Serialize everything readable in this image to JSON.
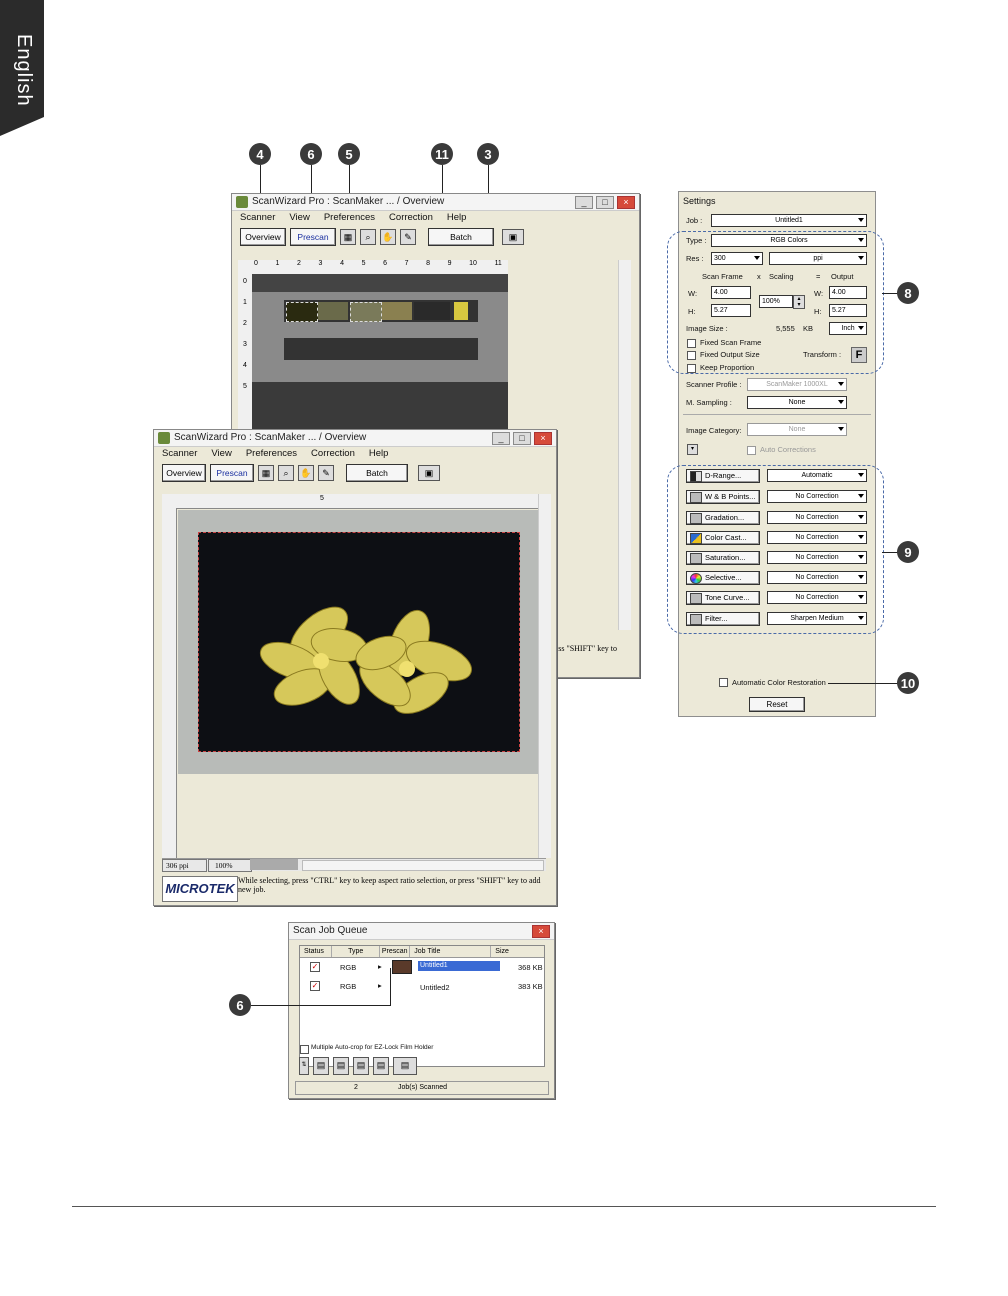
{
  "side_tab": {
    "label": "English"
  },
  "callouts": {
    "c4": "4",
    "c6a": "6",
    "c5": "5",
    "c11": "11",
    "c3": "3",
    "c8": "8",
    "c9": "9",
    "c10": "10",
    "c6b": "6"
  },
  "back_window": {
    "title": "ScanWizard Pro : ScanMaker ... / Overview",
    "menus": [
      "Scanner",
      "View",
      "Preferences",
      "Correction",
      "Help"
    ],
    "overview_label": "Overview",
    "prescan_label": "Prescan",
    "batch_label": "Batch",
    "ruler_numbers": [
      "0",
      "1",
      "2",
      "3",
      "4",
      "5",
      "6",
      "7",
      "8",
      "9",
      "10",
      "11"
    ],
    "left_ruler_numbers": [
      "0",
      "1",
      "2",
      "3",
      "4",
      "5"
    ],
    "status_text": "ress \"SHIFT\" key to"
  },
  "front_window": {
    "title": "ScanWizard Pro : ScanMaker ... / Overview",
    "menus": [
      "Scanner",
      "View",
      "Preferences",
      "Correction",
      "Help"
    ],
    "overview_label": "Overview",
    "prescan_label": "Prescan",
    "batch_label": "Batch",
    "ruler_mark": "5",
    "resolution": "306 ppi",
    "zoom": "100%",
    "brand": "MICROTEK",
    "status_text": "While selecting, press \"CTRL\" key to keep aspect ratio selection, or press \"SHIFT\" key to add new job."
  },
  "settings": {
    "title": "Settings",
    "job_label": "Job :",
    "job_value": "Untitled1",
    "type_label": "Type :",
    "type_value": "RGB Colors",
    "res_label": "Res :",
    "res_value": "300",
    "res_unit": "ppi",
    "scan_frame_label": "Scan Frame",
    "x_label": "x",
    "scaling_label": "Scaling",
    "eq_label": "=",
    "output_label": "Output",
    "w_label": "W:",
    "h_label": "H:",
    "w_value": "4.00",
    "h_value": "5.27",
    "scale_value": "100%",
    "out_w_value": "4.00",
    "out_h_value": "5.27",
    "image_size_label": "Image Size :",
    "image_size_value": "5,555",
    "image_size_unit": "KB",
    "inch_value": "Inch",
    "fixed_scan_frame": "Fixed Scan Frame",
    "fixed_output_size": "Fixed Output Size",
    "transform_label": "Transform :",
    "transform_glyph": "F",
    "keep_proportion": "Keep Proportion",
    "scanner_profile_label": "Scanner Profile :",
    "scanner_profile_value": "ScanMaker 1000XL",
    "m_sampling_label": "M. Sampling :",
    "m_sampling_value": "None",
    "image_category_label": "Image Category:",
    "image_category_value": "None",
    "auto_corrections": "Auto Corrections",
    "tools": [
      {
        "label": "D-Range...",
        "value": "Automatic"
      },
      {
        "label": "W & B Points...",
        "value": "No Correction"
      },
      {
        "label": "Gradation...",
        "value": "No Correction"
      },
      {
        "label": "Color Cast...",
        "value": "No Correction"
      },
      {
        "label": "Saturation...",
        "value": "No Correction"
      },
      {
        "label": "Selective...",
        "value": "No Correction"
      },
      {
        "label": "Tone Curve...",
        "value": "No Correction"
      },
      {
        "label": "Filter...",
        "value": "Sharpen Medium"
      }
    ],
    "auto_color_restoration": "Automatic Color Restoration",
    "reset_label": "Reset"
  },
  "queue": {
    "title": "Scan Job Queue",
    "columns": [
      "Status",
      "Type",
      "Prescan",
      "Job Title",
      "Size"
    ],
    "rows": [
      {
        "type": "RGB",
        "title": "Untitled1",
        "size": "368 KB"
      },
      {
        "type": "RGB",
        "title": "Untitled2",
        "size": "383 KB"
      }
    ],
    "multi_crop": "Multiple Auto-crop for EZ-Lock Film Holder",
    "footer_count": "2",
    "footer_text": "Job(s) Scanned"
  }
}
